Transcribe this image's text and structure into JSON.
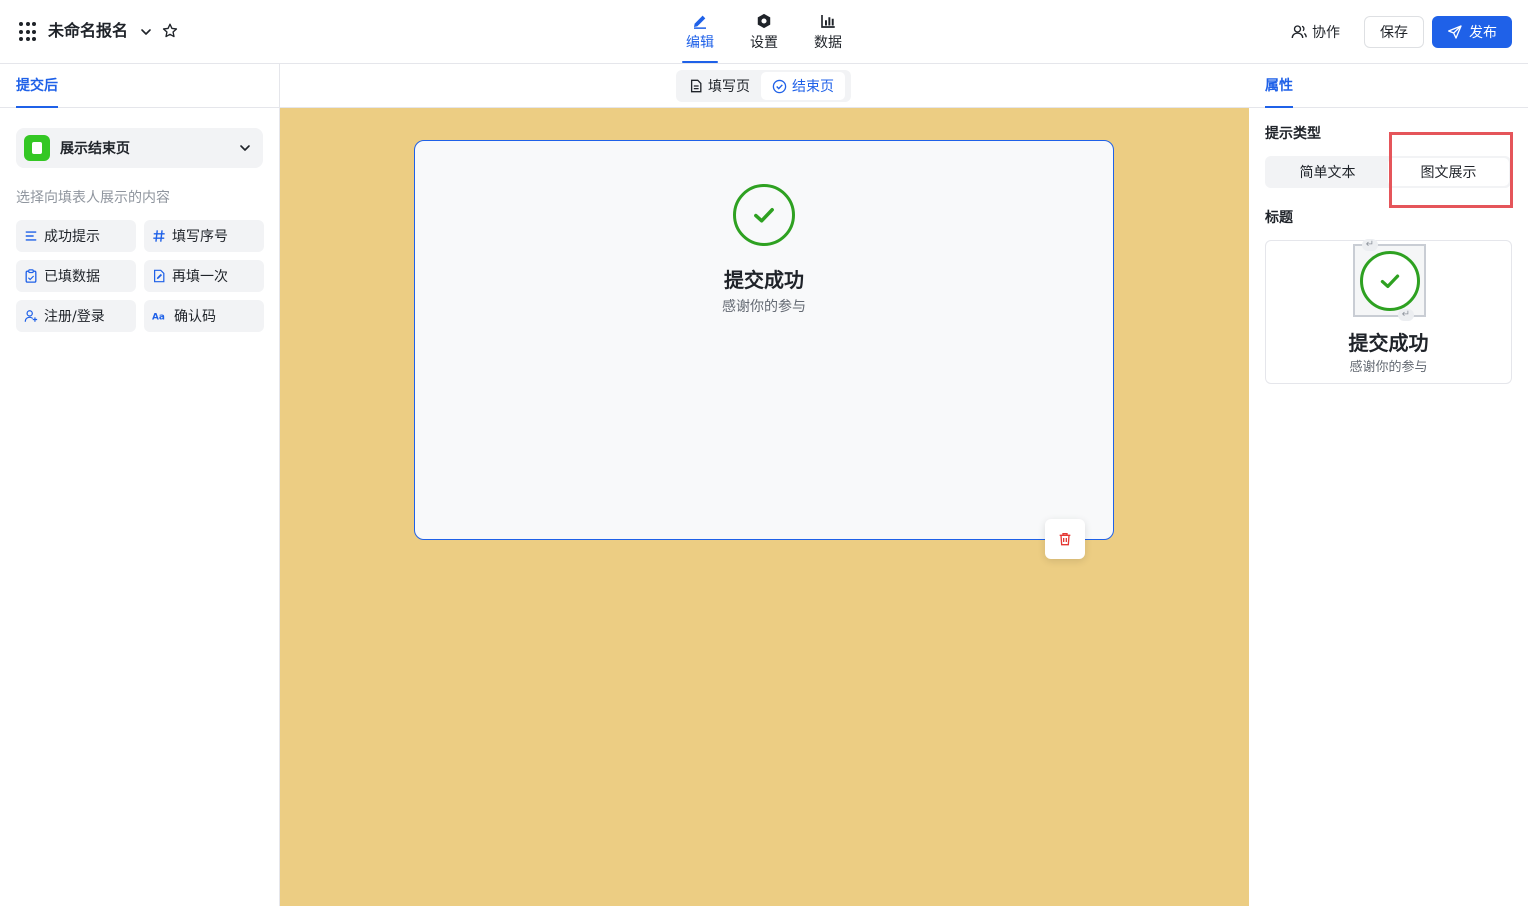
{
  "header": {
    "title": "未命名报名",
    "nav_tabs": [
      {
        "label": "编辑",
        "icon": "pencil-icon",
        "active": true
      },
      {
        "label": "设置",
        "icon": "settings-icon",
        "active": false
      },
      {
        "label": "数据",
        "icon": "bar-chart-icon",
        "active": false
      }
    ],
    "collab_label": "协作",
    "save_label": "保存",
    "publish_label": "发布",
    "accent_color": "#1f61e8"
  },
  "left_panel": {
    "tab_label": "提交后",
    "endpage_select_value": "展示结束页",
    "hint": "选择向填表人展示的内容",
    "chips": [
      {
        "label": "成功提示",
        "icon": "lines-icon"
      },
      {
        "label": "填写序号",
        "icon": "hash-icon"
      },
      {
        "label": "已填数据",
        "icon": "clipboard-icon"
      },
      {
        "label": "再填一次",
        "icon": "edit-doc-icon"
      },
      {
        "label": "注册/登录",
        "icon": "user-add-icon"
      },
      {
        "label": "确认码",
        "icon": "text-aa-icon"
      }
    ]
  },
  "canvas": {
    "page_toggle": [
      {
        "label": "填写页",
        "active": false
      },
      {
        "label": "结束页",
        "active": true
      }
    ],
    "card_title": "提交成功",
    "card_subtitle": "感谢你的参与",
    "background_color": "#eccd83",
    "success_color": "#2ea121"
  },
  "right_panel": {
    "tab_label": "属性",
    "prompt_type_label": "提示类型",
    "prompt_type_options": [
      "简单文本",
      "图文展示"
    ],
    "prompt_type_selected": "图文展示",
    "title_label": "标题",
    "preview_title": "提交成功",
    "preview_subtitle": "感谢你的参与"
  }
}
